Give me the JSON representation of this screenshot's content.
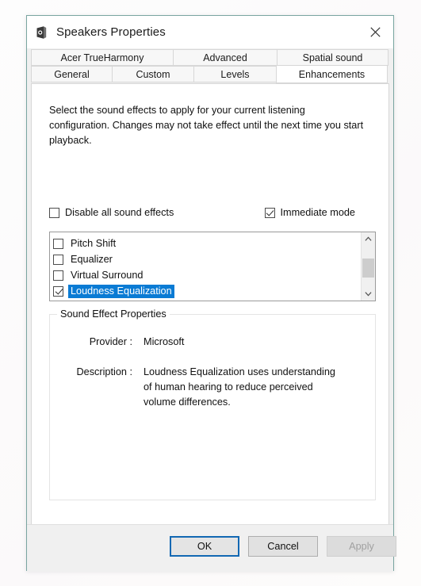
{
  "window": {
    "title": "Speakers Properties",
    "icon": "speaker-icon",
    "close_label": "✕"
  },
  "tabs": {
    "row1": [
      {
        "label": "Acer TrueHarmony",
        "selected": false
      },
      {
        "label": "Advanced",
        "selected": false
      },
      {
        "label": "Spatial sound",
        "selected": false
      }
    ],
    "row2": [
      {
        "label": "General",
        "selected": false
      },
      {
        "label": "Custom",
        "selected": false
      },
      {
        "label": "Levels",
        "selected": false
      },
      {
        "label": "Enhancements",
        "selected": true
      }
    ]
  },
  "enhancements": {
    "intro": "Select the sound effects to apply for your current listening configuration. Changes may not take effect until the next time you start playback.",
    "disable_all": {
      "label": "Disable all sound effects",
      "checked": false
    },
    "immediate_mode": {
      "label": "Immediate mode",
      "checked": true
    },
    "effects": [
      {
        "label": "Pitch Shift",
        "checked": false,
        "selected": false
      },
      {
        "label": "Equalizer",
        "checked": false,
        "selected": false
      },
      {
        "label": "Virtual Surround",
        "checked": false,
        "selected": false
      },
      {
        "label": "Loudness Equalization",
        "checked": true,
        "selected": true
      }
    ],
    "scrollbar": {
      "up_icon": "chevron-up-icon",
      "down_icon": "chevron-down-icon"
    },
    "properties": {
      "group_title": "Sound Effect Properties",
      "provider_label": "Provider :",
      "provider_value": "Microsoft",
      "description_label": "Description :",
      "description_value": "Loudness Equalization uses understanding of human hearing to reduce perceived volume differences."
    }
  },
  "footer": {
    "ok": "OK",
    "cancel": "Cancel",
    "apply": "Apply",
    "apply_disabled": true
  },
  "colors": {
    "selection_blue": "#0a7bd4",
    "default_button_border": "#1268b3",
    "window_border": "#79a5a1",
    "dialog_bg": "#f0f0f0"
  }
}
